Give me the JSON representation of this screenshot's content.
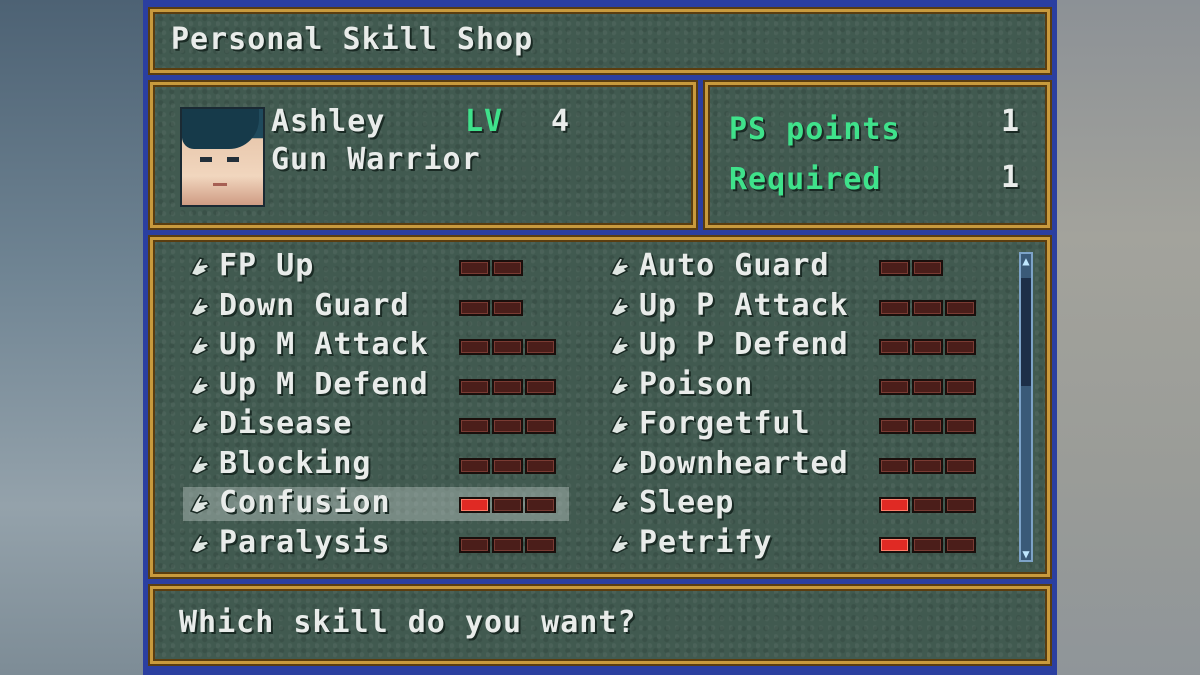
{
  "title": "Personal Skill Shop",
  "character": {
    "name": "Ashley",
    "level_label": "LV",
    "level": "4",
    "class": "Gun Warrior"
  },
  "points": {
    "ps_label": "PS points",
    "ps_value": "1",
    "required_label": "Required",
    "required_value": "1"
  },
  "skills_left": [
    {
      "name": "FP Up",
      "max": 2,
      "level": 0
    },
    {
      "name": "Down Guard",
      "max": 2,
      "level": 0
    },
    {
      "name": "Up M Attack",
      "max": 3,
      "level": 0
    },
    {
      "name": "Up M Defend",
      "max": 3,
      "level": 0
    },
    {
      "name": "Disease",
      "max": 3,
      "level": 0
    },
    {
      "name": "Blocking",
      "max": 3,
      "level": 0
    },
    {
      "name": "Confusion",
      "max": 3,
      "level": 1,
      "selected": true
    },
    {
      "name": "Paralysis",
      "max": 3,
      "level": 0
    }
  ],
  "skills_right": [
    {
      "name": "Auto Guard",
      "max": 2,
      "level": 0
    },
    {
      "name": "Up P Attack",
      "max": 3,
      "level": 0
    },
    {
      "name": "Up P Defend",
      "max": 3,
      "level": 0
    },
    {
      "name": "Poison",
      "max": 3,
      "level": 0
    },
    {
      "name": "Forgetful",
      "max": 3,
      "level": 0
    },
    {
      "name": "Downhearted",
      "max": 3,
      "level": 0
    },
    {
      "name": "Sleep",
      "max": 3,
      "level": 1
    },
    {
      "name": "Petrify",
      "max": 3,
      "level": 1
    }
  ],
  "prompt": "Which skill do you want?",
  "colors": {
    "panel": "#415a50",
    "border": "#c89a3d",
    "accent_green": "#3fe28b",
    "meter_on": "#e02a24"
  },
  "icons": {
    "skill_marker": "pointing-hand-icon"
  }
}
